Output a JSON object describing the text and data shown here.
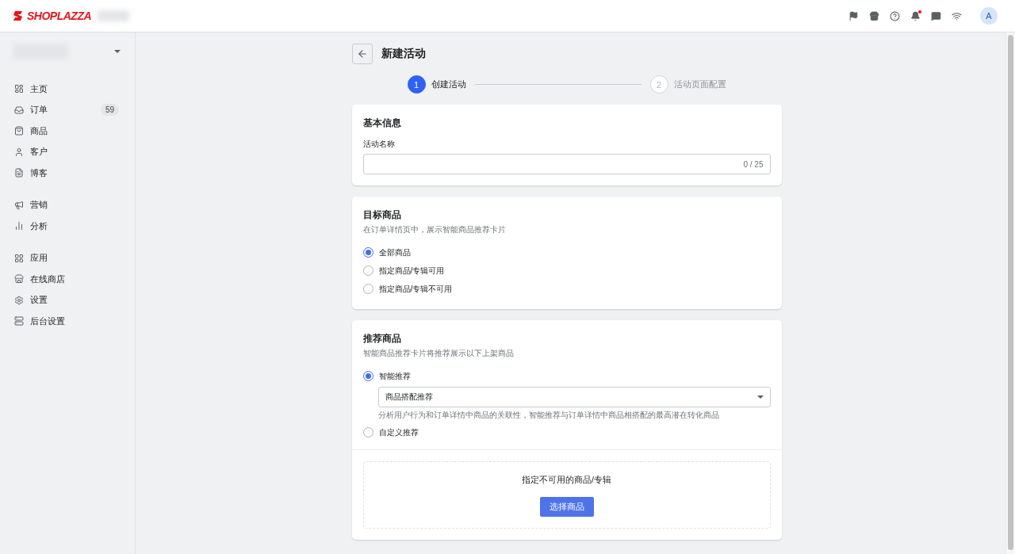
{
  "topbar": {
    "logo": "SHOPLAZZA",
    "avatar": "A",
    "bell_dot": true
  },
  "sidebar": {
    "groups": [
      [
        {
          "label": "主页"
        },
        {
          "label": "订单",
          "badge": "59"
        },
        {
          "label": "商品"
        },
        {
          "label": "客户"
        },
        {
          "label": "博客"
        }
      ],
      [
        {
          "label": "营销"
        },
        {
          "label": "分析"
        }
      ],
      [
        {
          "label": "应用"
        },
        {
          "label": "在线商店"
        },
        {
          "label": "设置"
        },
        {
          "label": "后台设置"
        }
      ]
    ]
  },
  "page": {
    "title": "新建活动"
  },
  "steps": [
    {
      "number": "1",
      "label": "创建活动",
      "selected": true
    },
    {
      "number": "2",
      "label": "活动页面配置",
      "selected": false
    }
  ],
  "basic": {
    "title": "基本信息",
    "field_label": "活动名称",
    "counter": "0 / 25"
  },
  "target": {
    "title": "目标商品",
    "description": "在订单详情页中，展示智能商品推荐卡片",
    "options": [
      {
        "label": "全部商品",
        "selected": true
      },
      {
        "label": "指定商品/专辑可用",
        "selected": false
      },
      {
        "label": "指定商品/专辑不可用",
        "selected": false
      }
    ]
  },
  "recommend": {
    "title": "推荐商品",
    "description": "智能商品推荐卡片将推荐展示以下上架商品",
    "options": [
      {
        "label": "智能推荐",
        "selected": true,
        "select_value": "商品搭配推荐",
        "hint": "分析用户行为和订单详情中商品的关联性，智能推荐与订单详情中商品相搭配的最高潜在转化商品"
      },
      {
        "label": "自定义推荐",
        "selected": false
      }
    ],
    "picker": {
      "title": "指定不可用的商品/专辑",
      "button": "选择商品"
    }
  }
}
